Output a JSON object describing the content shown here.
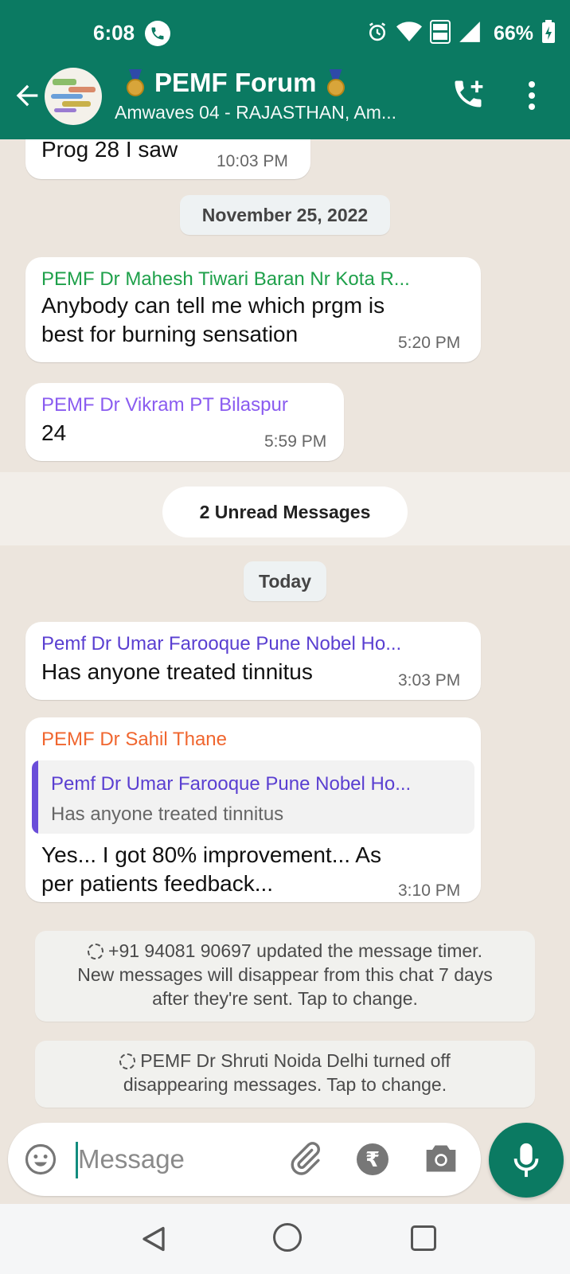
{
  "status": {
    "time": "6:08",
    "battery": "66%"
  },
  "header": {
    "title": "PEMF Forum",
    "subtitle": "Amwaves 04 - RAJASTHAN, Am..."
  },
  "messages": [
    {
      "text": "Prog 28 I saw",
      "time": "10:03 PM"
    },
    {
      "sender": "PEMF Dr Mahesh Tiwari Baran Nr Kota R...",
      "sender_color": "#1ea04a",
      "text_line1": "Anybody can tell me which prgm is",
      "text_line2": "best for burning sensation",
      "time": "5:20 PM"
    },
    {
      "sender": "PEMF Dr Vikram PT Bilaspur",
      "sender_color": "#8a5cf0",
      "text": "24",
      "time": "5:59 PM"
    },
    {
      "sender": "Pemf Dr Umar Farooque Pune Nobel Ho...",
      "sender_color": "#5a3fd1",
      "text": "Has anyone treated tinnitus",
      "time": "3:03 PM"
    },
    {
      "sender": "PEMF Dr Sahil Thane",
      "sender_color": "#f0662f",
      "quote_sender": "Pemf Dr Umar Farooque Pune Nobel Ho...",
      "quote_text": "Has anyone treated tinnitus",
      "text_line1": "Yes... I got 80% improvement... As",
      "text_line2": "per patients feedback...",
      "time": "3:10 PM"
    }
  ],
  "date_chips": {
    "first": "November 25, 2022",
    "second": "Today"
  },
  "unread": "2 Unread Messages",
  "system_messages": [
    {
      "line1": "+91 94081 90697 updated the message timer.",
      "line2": "New messages will disappear from this chat 7 days",
      "line3": "after they're sent. Tap to change."
    },
    {
      "line1": "PEMF Dr Shruti Noida Delhi turned off",
      "line2": "disappearing messages. Tap to change."
    }
  ],
  "composer": {
    "placeholder": "Message",
    "rupee_symbol": "₹"
  },
  "colors": {
    "header_bg": "#0b7a62",
    "chat_bg": "#ece5dd"
  }
}
